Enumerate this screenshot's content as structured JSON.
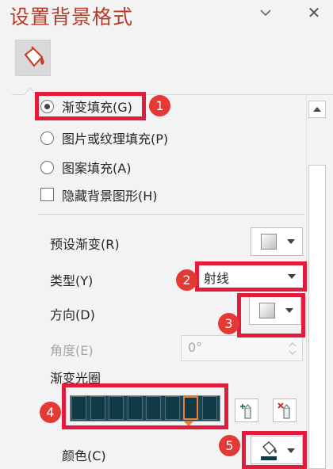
{
  "header": {
    "title": "设置背景格式",
    "close_glyph": "✕"
  },
  "fill_options": {
    "gradient_fill": "渐变填充(G)",
    "picture_texture_fill": "图片或纹理填充(P)",
    "pattern_fill": "图案填充(A)",
    "hide_background_graphics": "隐藏背景图形(H)",
    "selected": "gradient_fill"
  },
  "gradient_settings": {
    "preset_label": "预设渐变(R)",
    "type_label": "类型(Y)",
    "type_value": "射线",
    "direction_label": "方向(D)",
    "angle_label": "角度(E)",
    "angle_value": "0°",
    "stops_label": "渐变光圈",
    "stop_count": 8,
    "selected_stop_index": 6,
    "stop_color": "#103a44",
    "color_label": "颜色(C)"
  },
  "annotations": [
    "1",
    "2",
    "3",
    "4",
    "5"
  ],
  "colors": {
    "title": "#b83b2a",
    "highlight": "#e31c3d",
    "badge": "#e53935",
    "selected_stop_border": "#ed7d31"
  },
  "icons": {
    "fill_tab": "paint-bucket-icon",
    "add_stop": "add-gradient-stop-icon",
    "remove_stop": "remove-gradient-stop-icon",
    "color_picker": "paint-bucket-icon"
  }
}
